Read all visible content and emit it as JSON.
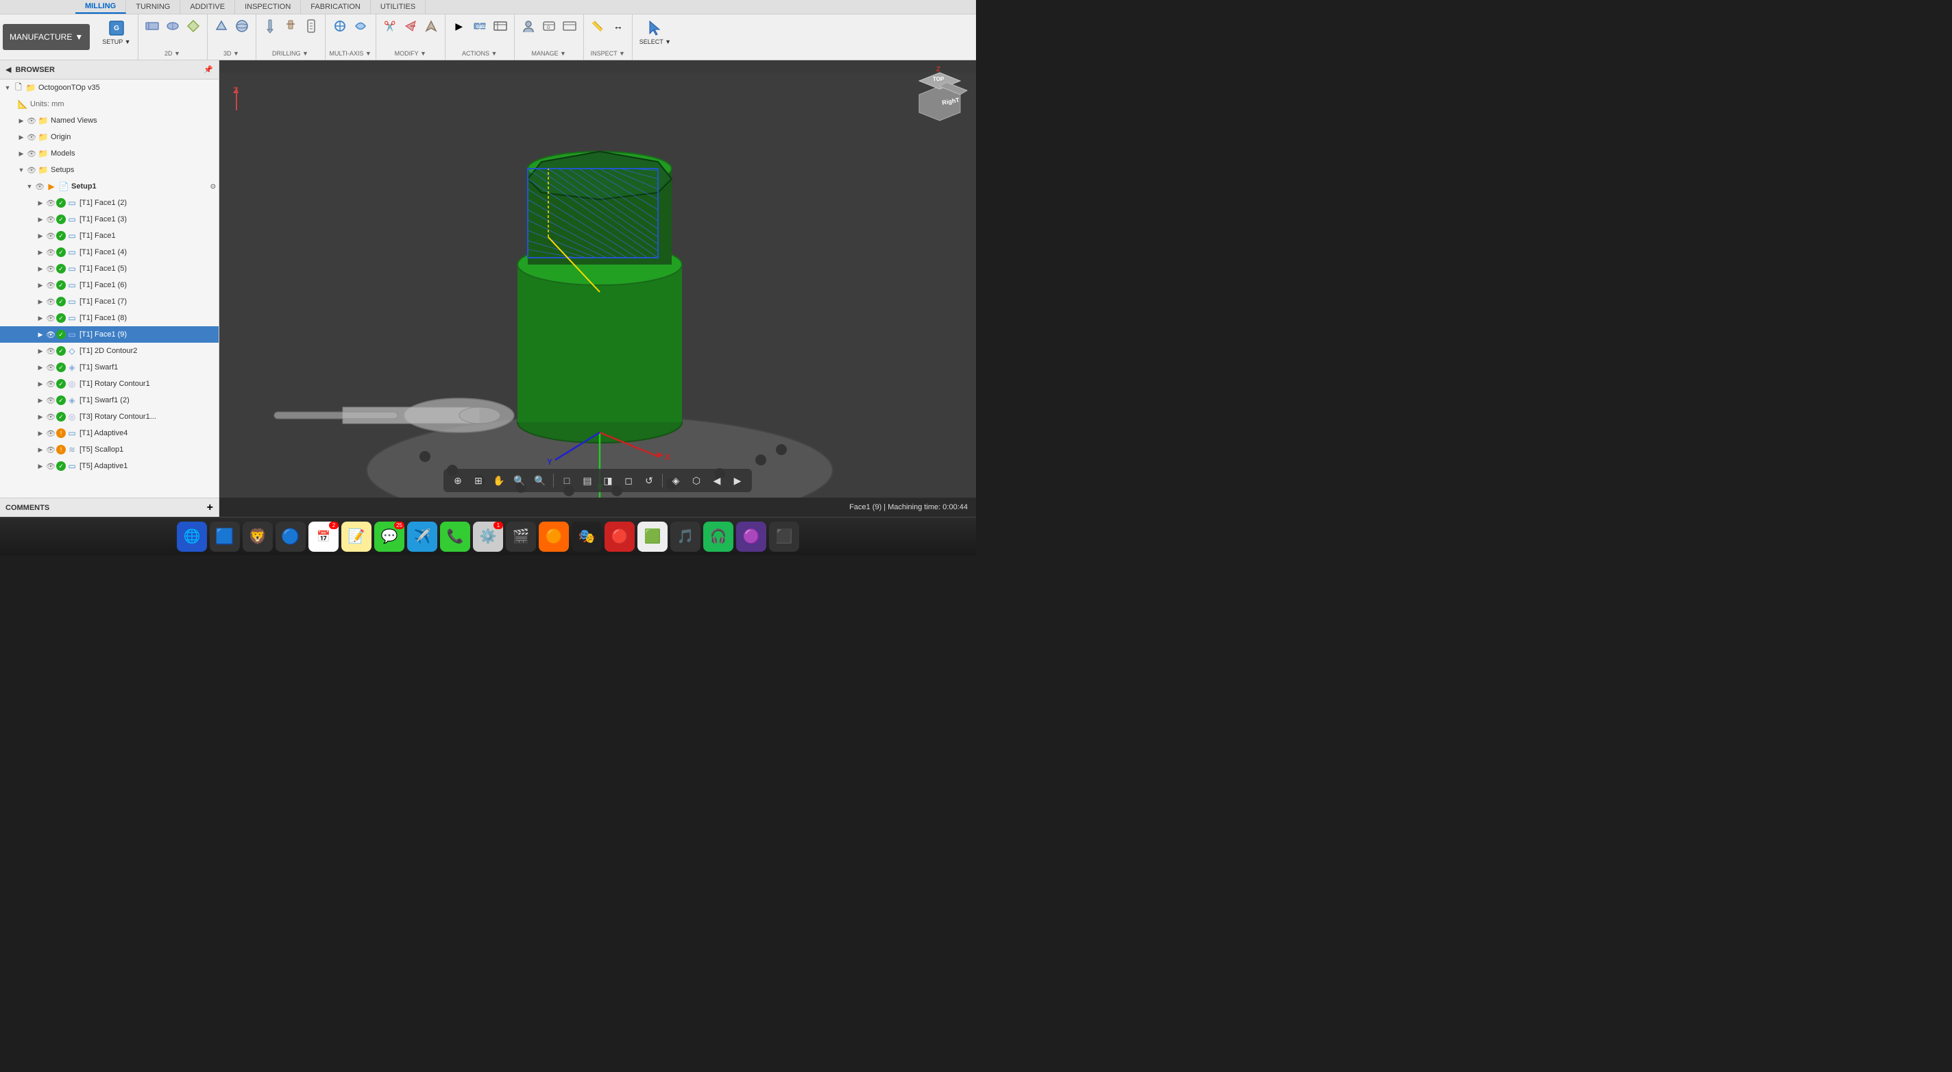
{
  "app": {
    "title": "OctogoonTOp v35",
    "mode": "MANUFACTURE"
  },
  "toolbar": {
    "manufacture_label": "MANUFACTURE",
    "tabs": [
      {
        "label": "MILLING",
        "active": true
      },
      {
        "label": "TURNING",
        "active": false
      },
      {
        "label": "ADDITIVE",
        "active": false
      },
      {
        "label": "INSPECTION",
        "active": false
      },
      {
        "label": "FABRICATION",
        "active": false
      },
      {
        "label": "UTILITIES",
        "active": false
      }
    ],
    "groups": [
      {
        "label": "SETUP",
        "items": [
          "setup"
        ]
      },
      {
        "label": "2D",
        "items": [
          "2d"
        ]
      },
      {
        "label": "3D",
        "items": [
          "3d"
        ]
      },
      {
        "label": "DRILLING",
        "items": [
          "drilling"
        ]
      },
      {
        "label": "MULTI-AXIS",
        "items": [
          "multiaxis"
        ]
      },
      {
        "label": "MODIFY",
        "items": [
          "modify"
        ]
      },
      {
        "label": "ACTIONS",
        "items": [
          "actions"
        ]
      },
      {
        "label": "MANAGE",
        "items": [
          "manage"
        ]
      },
      {
        "label": "INSPECT",
        "items": [
          "inspect"
        ]
      },
      {
        "label": "SELECT",
        "items": [
          "select"
        ]
      }
    ]
  },
  "sidebar": {
    "header": "BROWSER",
    "root_item": "OctogoonTOp v35",
    "units": "Units: mm",
    "items": [
      {
        "label": "Named Views",
        "indent": 1,
        "type": "folder",
        "expanded": false
      },
      {
        "label": "Origin",
        "indent": 1,
        "type": "folder",
        "expanded": false
      },
      {
        "label": "Models",
        "indent": 1,
        "type": "folder",
        "expanded": false
      },
      {
        "label": "Setups",
        "indent": 1,
        "type": "folder",
        "expanded": true
      },
      {
        "label": "Setup1",
        "indent": 2,
        "type": "setup",
        "expanded": true
      },
      {
        "label": "[T1] Face1 (2)",
        "indent": 3,
        "type": "op",
        "status": "green"
      },
      {
        "label": "[T1] Face1 (3)",
        "indent": 3,
        "type": "op",
        "status": "green"
      },
      {
        "label": "[T1] Face1",
        "indent": 3,
        "type": "op",
        "status": "green"
      },
      {
        "label": "[T1] Face1 (4)",
        "indent": 3,
        "type": "op",
        "status": "green"
      },
      {
        "label": "[T1] Face1 (5)",
        "indent": 3,
        "type": "op",
        "status": "green"
      },
      {
        "label": "[T1] Face1 (6)",
        "indent": 3,
        "type": "op",
        "status": "green"
      },
      {
        "label": "[T1] Face1 (7)",
        "indent": 3,
        "type": "op",
        "status": "green"
      },
      {
        "label": "[T1] Face1 (8)",
        "indent": 3,
        "type": "op",
        "status": "green"
      },
      {
        "label": "[T1] Face1 (9)",
        "indent": 3,
        "type": "op",
        "status": "green",
        "selected": true
      },
      {
        "label": "[T1] 2D Contour2",
        "indent": 3,
        "type": "op",
        "status": "green"
      },
      {
        "label": "[T1] Swarf1",
        "indent": 3,
        "type": "op",
        "status": "green"
      },
      {
        "label": "[T1] Rotary Contour1",
        "indent": 3,
        "type": "op",
        "status": "green"
      },
      {
        "label": "[T1] Swarf1 (2)",
        "indent": 3,
        "type": "op",
        "status": "green"
      },
      {
        "label": "[T3] Rotary Contour1...",
        "indent": 3,
        "type": "op",
        "status": "green"
      },
      {
        "label": "[T1] Adaptive4",
        "indent": 3,
        "type": "op",
        "status": "orange"
      },
      {
        "label": "[T5] Scallop1",
        "indent": 3,
        "type": "op",
        "status": "orange"
      },
      {
        "label": "[T5] Adaptive1",
        "indent": 3,
        "type": "op",
        "status": "green"
      }
    ],
    "footer": "COMMENTS",
    "add_comment_label": "+"
  },
  "status_bar": {
    "text": "Face1 (9) | Machining time: 0:00:44"
  },
  "view_cube": {
    "label": "RighT"
  },
  "dock": {
    "items": [
      {
        "icon": "🌐",
        "label": "finder"
      },
      {
        "icon": "🟦",
        "label": "launchpad"
      },
      {
        "icon": "🦁",
        "label": "brave"
      },
      {
        "icon": "🔵",
        "label": "chrome"
      },
      {
        "icon": "📅",
        "label": "calendar",
        "badge": "2"
      },
      {
        "icon": "🟡",
        "label": "notes"
      },
      {
        "icon": "📱",
        "label": "messages",
        "badge": "25"
      },
      {
        "icon": "✈️",
        "label": "telegram"
      },
      {
        "icon": "📞",
        "label": "phone"
      },
      {
        "icon": "⚙️",
        "label": "system-preferences",
        "badge": "1"
      },
      {
        "icon": "🎬",
        "label": "app1"
      },
      {
        "icon": "🟠",
        "label": "app2"
      },
      {
        "icon": "🎭",
        "label": "figma"
      },
      {
        "icon": "🔴",
        "label": "app3"
      },
      {
        "icon": "🟩",
        "label": "fusion"
      },
      {
        "icon": "🎵",
        "label": "music"
      },
      {
        "icon": "💚",
        "label": "spotify"
      },
      {
        "icon": "🟣",
        "label": "app4"
      },
      {
        "icon": "🔲",
        "label": "app5"
      }
    ]
  }
}
